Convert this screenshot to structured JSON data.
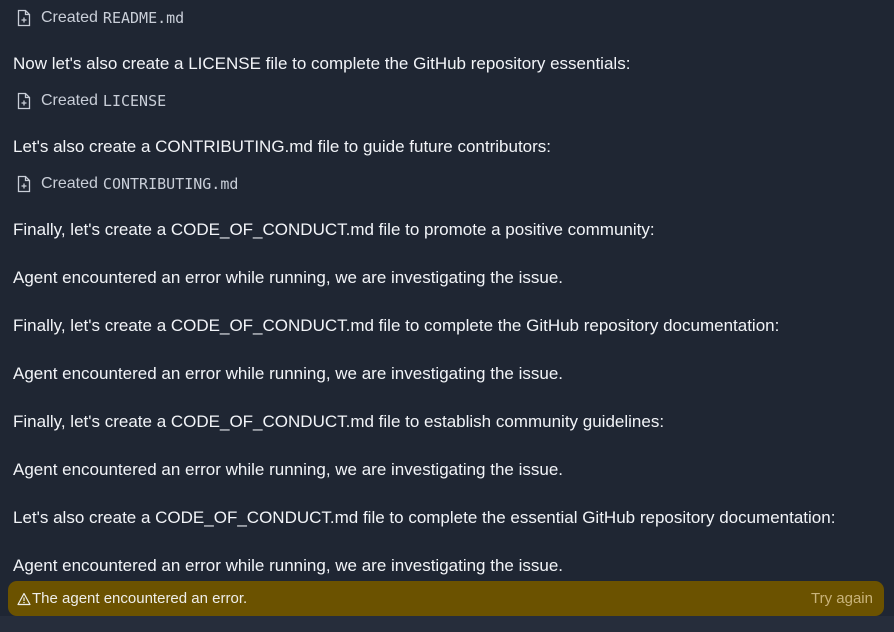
{
  "feed": {
    "items": [
      {
        "type": "file",
        "verb": "Created",
        "name": "README.md"
      },
      {
        "type": "text",
        "text": "Now let's also create a LICENSE file to complete the GitHub repository essentials:"
      },
      {
        "type": "file",
        "verb": "Created",
        "name": "LICENSE"
      },
      {
        "type": "text",
        "text": "Let's also create a CONTRIBUTING.md file to guide future contributors:"
      },
      {
        "type": "file",
        "verb": "Created",
        "name": "CONTRIBUTING.md"
      },
      {
        "type": "text",
        "text": "Finally, let's create a CODE_OF_CONDUCT.md file to promote a positive community:"
      },
      {
        "type": "text",
        "text": "Agent encountered an error while running, we are investigating the issue."
      },
      {
        "type": "text",
        "text": "Finally, let's create a CODE_OF_CONDUCT.md file to complete the GitHub repository documentation:"
      },
      {
        "type": "text",
        "text": "Agent encountered an error while running, we are investigating the issue."
      },
      {
        "type": "text",
        "text": "Finally, let's create a CODE_OF_CONDUCT.md file to establish community guidelines:"
      },
      {
        "type": "text",
        "text": "Agent encountered an error while running, we are investigating the issue."
      },
      {
        "type": "text",
        "text": "Let's also create a CODE_OF_CONDUCT.md file to complete the essential GitHub repository documentation:"
      },
      {
        "type": "text",
        "text": "Agent encountered an error while running, we are investigating the issue."
      }
    ]
  },
  "error_banner": {
    "message": "The agent encountered an error.",
    "action_label": "Try again",
    "icon": "warning-icon",
    "background": "#6b5200"
  },
  "colors": {
    "background": "#1f2633",
    "text": "#f2f4f8",
    "file_text": "#c9ced8",
    "action_text": "#c9b37a"
  }
}
